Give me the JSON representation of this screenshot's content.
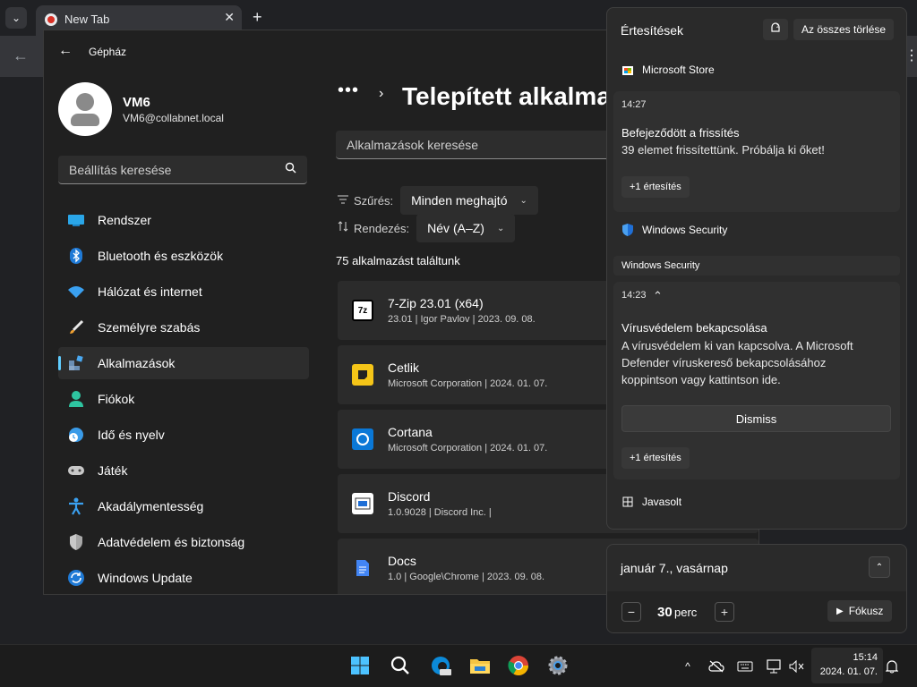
{
  "browser": {
    "tab_title": "New Tab",
    "tab_close": "✕",
    "new_tab": "+",
    "tab_search": "⌄",
    "back": "←",
    "menu": "⋮"
  },
  "settings": {
    "back": "←",
    "app_title": "Gépház",
    "user": {
      "name": "VM6",
      "email": "VM6@collabnet.local"
    },
    "search_placeholder": "Beállítás keresése",
    "nav": [
      {
        "label": "Rendszer"
      },
      {
        "label": "Bluetooth és eszközök"
      },
      {
        "label": "Hálózat és internet"
      },
      {
        "label": "Személyre szabás"
      },
      {
        "label": "Alkalmazások"
      },
      {
        "label": "Fiókok"
      },
      {
        "label": "Idő és nyelv"
      },
      {
        "label": "Játék"
      },
      {
        "label": "Akadálymentesség"
      },
      {
        "label": "Adatvédelem és biztonság"
      },
      {
        "label": "Windows Update"
      }
    ],
    "active_nav_index": 4,
    "breadcrumb_more": "•••",
    "breadcrumb_chevron": "›",
    "page_title": "Telepített alkalmazások",
    "app_search_placeholder": "Alkalmazások keresése",
    "filter_label": "Szűrés:",
    "filter_value": "Minden meghajtó",
    "sort_label": "Rendezés:",
    "sort_value": "Név (A–Z)",
    "dropdown_chevron": "⌄",
    "found_text": "75 alkalmazást találtunk",
    "apps": [
      {
        "name": "7-Zip 23.01 (x64)",
        "meta": "23.01  |  Igor Pavlov  |  2023. 09. 08.",
        "icon_text": "7z"
      },
      {
        "name": "Cetlik",
        "meta": "Microsoft Corporation  |  2024. 01. 07.",
        "icon_text": ""
      },
      {
        "name": "Cortana",
        "meta": "Microsoft Corporation  |  2024. 01. 07.",
        "icon_text": ""
      },
      {
        "name": "Discord",
        "meta": "1.0.9028  |  Discord Inc.  |",
        "icon_text": ""
      },
      {
        "name": "Docs",
        "meta": "1.0  |  Google\\Chrome  |  2023. 09. 08.",
        "icon_text": ""
      }
    ]
  },
  "notifications": {
    "title": "Értesítések",
    "clear_all": "Az összes törlése",
    "store": {
      "source": "Microsoft Store",
      "time": "14:27",
      "title": "Befejeződött a frissítés",
      "body": "39 elemet frissítettünk. Próbálja ki őket!",
      "more": "+1 értesítés"
    },
    "security": {
      "source": "Windows Security",
      "group": "Windows Security",
      "time": "14:23",
      "time_chevron": "⌃",
      "title": "Vírusvédelem bekapcsolása",
      "body": [
        "A vírusvédelem ki van kapcsolva. A Microsoft",
        "Defender víruskereső bekapcsolásához",
        "koppintson vagy kattintson ide."
      ],
      "dismiss": "Dismiss",
      "more": "+1 értesítés"
    },
    "suggested": "Javasolt"
  },
  "calendar": {
    "date": "január 7., vasárnap",
    "expand": "⌃",
    "minus": "−",
    "minutes": "30",
    "unit": "perc",
    "plus": "+",
    "focus_play": "▶",
    "focus_label": "Fókusz"
  },
  "taskbar": {
    "time": "15:14",
    "date": "2024. 01. 07.",
    "tray_chevron": "^"
  },
  "colors": {
    "accent": "#60cdff",
    "windows_blue": "#0078d4",
    "security_blue": "#1f6fd6"
  }
}
